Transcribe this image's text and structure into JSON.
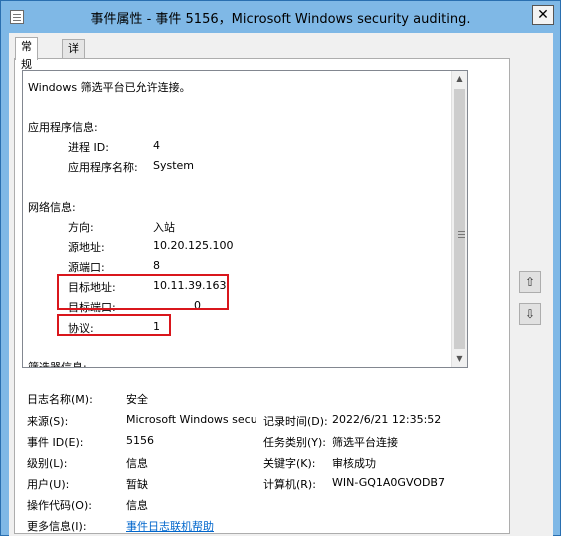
{
  "window": {
    "title": "事件属性 - 事件 5156，Microsoft Windows security auditing.",
    "close_glyph": "✕"
  },
  "tabs": [
    {
      "label": "常规",
      "active": true
    },
    {
      "label": "详细信息",
      "active": false
    }
  ],
  "description": {
    "summary": "Windows 筛选平台已允许连接。",
    "app_header": "应用程序信息:",
    "process_id_label": "进程 ID:",
    "process_id_value": "4",
    "app_name_label": "应用程序名称:",
    "app_name_value": "System",
    "network_header": "网络信息:",
    "direction_label": "方向:",
    "direction_value": "入站",
    "source_addr_label": "源地址:",
    "source_addr_value": "10.20.125.100",
    "source_port_label": "源端口:",
    "source_port_value": "8",
    "dest_addr_label": "目标地址:",
    "dest_addr_value": "10.11.39.163",
    "dest_port_label": "目标端口:",
    "dest_port_value": "0",
    "protocol_label": "协议:",
    "protocol_value": "1",
    "filter_header": "筛选器信息:"
  },
  "meta": {
    "log_name_label": "日志名称(M):",
    "log_name_value": "安全",
    "source_label": "来源(S):",
    "source_value": "Microsoft Windows secur",
    "logged_label": "记录时间(D):",
    "logged_value": "2022/6/21 12:35:52",
    "event_id_label": "事件 ID(E):",
    "event_id_value": "5156",
    "task_label": "任务类别(Y):",
    "task_value": "筛选平台连接",
    "level_label": "级别(L):",
    "level_value": "信息",
    "keywords_label": "关键字(K):",
    "keywords_value": "审核成功",
    "user_label": "用户(U):",
    "user_value": "暂缺",
    "computer_label": "计算机(R):",
    "computer_value": "WIN-GQ1A0GVODB7",
    "opcode_label": "操作代码(O):",
    "opcode_value": "信息",
    "more_info_label": "更多信息(I):",
    "more_info_link": "事件日志联机帮助"
  },
  "icons": {
    "scroll_up": "▲",
    "scroll_down": "▼",
    "nav_up": "⇧",
    "nav_down": "⇩"
  },
  "colors": {
    "titlebar": "#7fb8e6",
    "highlight_box": "#d9161c",
    "link": "#0066cc"
  }
}
